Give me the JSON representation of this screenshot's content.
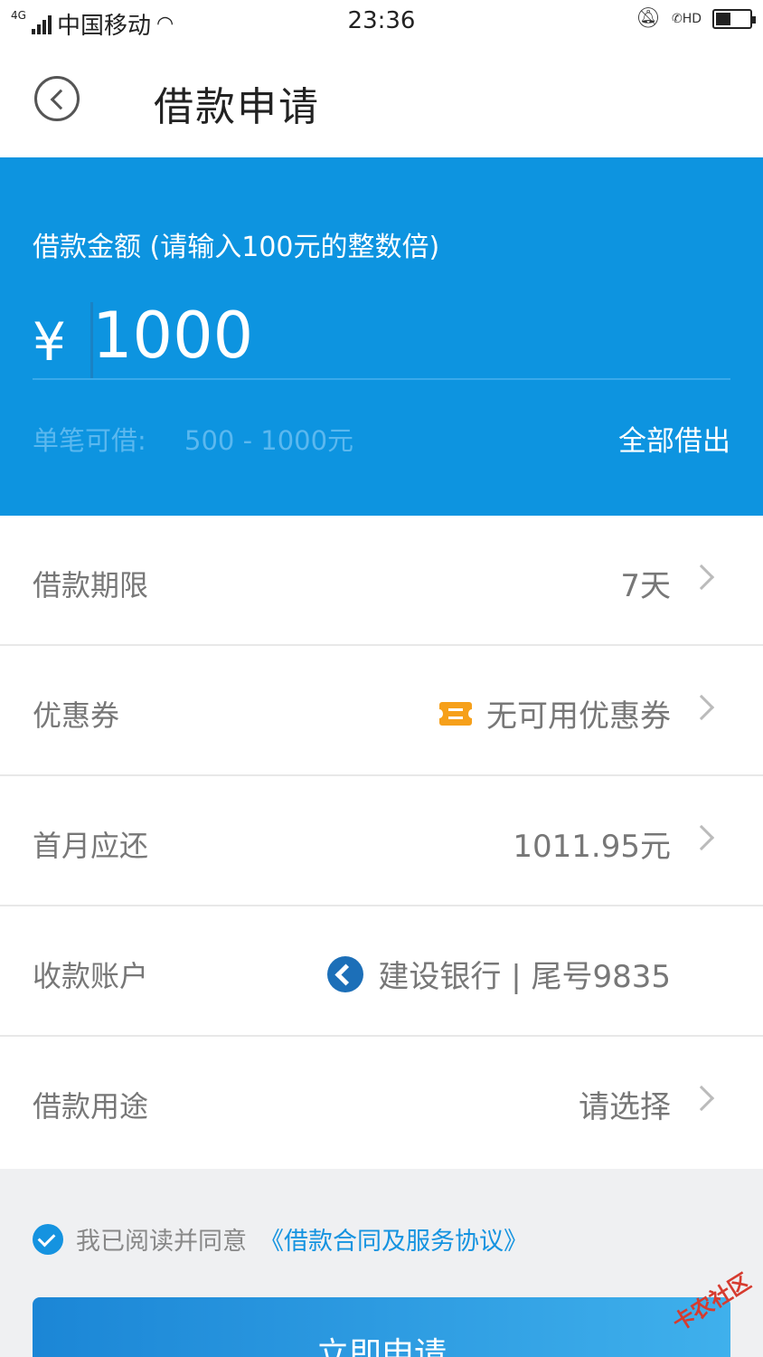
{
  "status_bar": {
    "network": "4G",
    "carrier": "中国移动",
    "time": "23:36",
    "hd": "HD"
  },
  "header": {
    "title": "借款申请"
  },
  "amount": {
    "label": "借款金额  (请输入100元的整数倍)",
    "currency": "¥",
    "value": "1000",
    "range_label": "单笔可借:",
    "range_value": "500 - 1000元",
    "borrow_all": "全部借出"
  },
  "rows": [
    {
      "label": "借款期限",
      "value": "7天"
    },
    {
      "label": "优惠券",
      "value": "无可用优惠券",
      "icon": "coupon-icon"
    },
    {
      "label": "首月应还",
      "value": "1011.95元"
    },
    {
      "label": "收款账户",
      "value": "建设银行 | 尾号9835",
      "icon": "bank-icon"
    },
    {
      "label": "借款用途",
      "value": "请选择"
    }
  ],
  "agreement": {
    "text": "我已阅读并同意",
    "link": "《借款合同及服务协议》",
    "checked": true
  },
  "submit_label": "立即申请",
  "watermark": "卡农社区",
  "colors": {
    "primary": "#0d94e0",
    "coupon": "#f6a01a",
    "bank": "#1c6fb8"
  },
  "battery_level": 0.45
}
